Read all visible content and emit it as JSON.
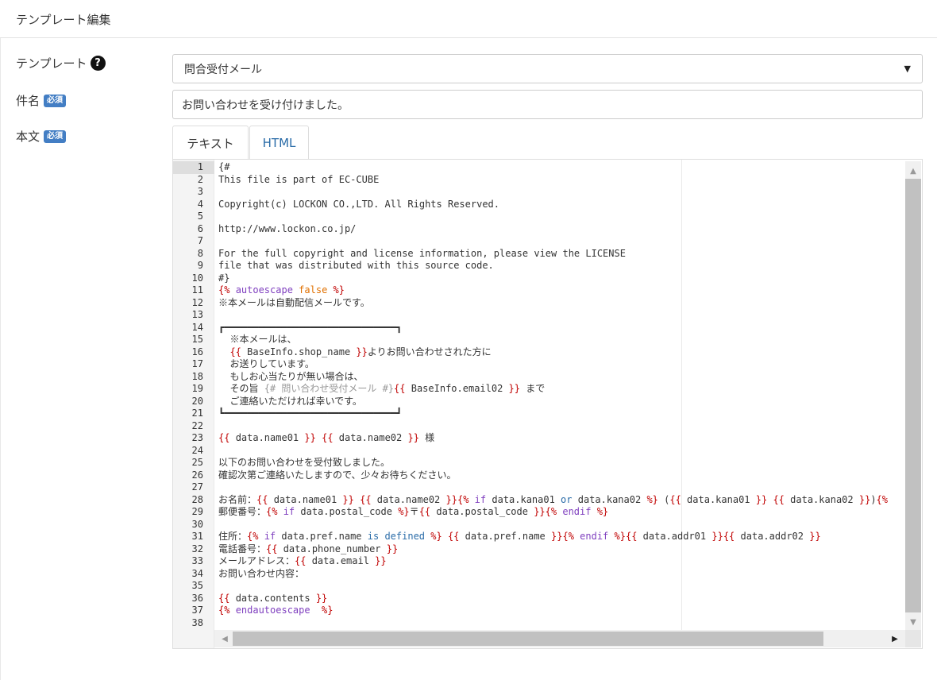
{
  "header": {
    "title": "テンプレート編集"
  },
  "form": {
    "template_label": "テンプレート",
    "subject_label": "件名",
    "body_label": "本文",
    "required_badge": "必須",
    "help_icon_glyph": "?",
    "template_select_value": "問合受付メール",
    "subject_value": "お問い合わせを受け付けました。"
  },
  "tabs": [
    {
      "label": "テキスト",
      "active": true
    },
    {
      "label": "HTML",
      "active": false
    }
  ],
  "editor": {
    "lines": [
      [
        [
          "{#",
          ""
        ]
      ],
      [
        [
          "This file is part of EC-CUBE",
          ""
        ]
      ],
      [
        [
          "",
          ""
        ]
      ],
      [
        [
          "Copyright(c) LOCKON CO.,LTD. All Rights Reserved.",
          ""
        ]
      ],
      [
        [
          "",
          ""
        ]
      ],
      [
        [
          "http://www.lockon.co.jp/",
          ""
        ]
      ],
      [
        [
          "",
          ""
        ]
      ],
      [
        [
          "For the full copyright and license information, please view the LICENSE",
          ""
        ]
      ],
      [
        [
          "file that was distributed with this source code.",
          ""
        ]
      ],
      [
        [
          "#}",
          ""
        ]
      ],
      [
        [
          "{% ",
          "tag"
        ],
        [
          "autoescape ",
          "kw"
        ],
        [
          "false",
          "bool"
        ],
        [
          " %}",
          "tag"
        ]
      ],
      [
        [
          "※本メールは自動配信メールです。",
          ""
        ]
      ],
      [
        [
          "",
          ""
        ]
      ],
      [
        [
          "┏━━━━━━━━━━━━━━━━━━━━━━━━━━━━━━┓",
          ""
        ]
      ],
      [
        [
          "  ※本メールは、",
          ""
        ]
      ],
      [
        [
          "  ",
          ""
        ],
        [
          "{{ ",
          "tag"
        ],
        [
          "BaseInfo.shop_name",
          ""
        ],
        [
          " }}",
          "tag"
        ],
        [
          "よりお問い合わせされた方に",
          ""
        ]
      ],
      [
        [
          "  お送りしています。",
          ""
        ]
      ],
      [
        [
          "  もしお心当たりが無い場合は、",
          ""
        ]
      ],
      [
        [
          "  その旨 ",
          ""
        ],
        [
          "{# 問い合わせ受付メール #}",
          "cm"
        ],
        [
          "{{ ",
          "tag"
        ],
        [
          "BaseInfo.email02",
          ""
        ],
        [
          " }}",
          "tag"
        ],
        [
          " まで",
          ""
        ]
      ],
      [
        [
          "  ご連絡いただければ幸いです。",
          ""
        ]
      ],
      [
        [
          "┗━━━━━━━━━━━━━━━━━━━━━━━━━━━━━━┛",
          ""
        ]
      ],
      [
        [
          "",
          ""
        ]
      ],
      [
        [
          "{{ ",
          "tag"
        ],
        [
          "data.name01",
          ""
        ],
        [
          " }}",
          "tag"
        ],
        [
          " ",
          ""
        ],
        [
          "{{ ",
          "tag"
        ],
        [
          "data.name02",
          ""
        ],
        [
          " }}",
          "tag"
        ],
        [
          " 様",
          ""
        ]
      ],
      [
        [
          "",
          ""
        ]
      ],
      [
        [
          "以下のお問い合わせを受付致しました。",
          ""
        ]
      ],
      [
        [
          "確認次第ご連絡いたしますので、少々お待ちください。",
          ""
        ]
      ],
      [
        [
          "",
          ""
        ]
      ],
      [
        [
          "お名前：",
          ""
        ],
        [
          "{{ ",
          "tag"
        ],
        [
          "data.name01",
          ""
        ],
        [
          " }}",
          "tag"
        ],
        [
          " ",
          ""
        ],
        [
          "{{ ",
          "tag"
        ],
        [
          "data.name02",
          ""
        ],
        [
          " }}",
          "tag"
        ],
        [
          "{% ",
          "tag"
        ],
        [
          "if ",
          "kw"
        ],
        [
          "data.kana01 ",
          ""
        ],
        [
          "or ",
          "op"
        ],
        [
          "data.kana02",
          ""
        ],
        [
          " %}",
          "tag"
        ],
        [
          " (",
          ""
        ],
        [
          "{{ ",
          "tag"
        ],
        [
          "data.kana01",
          ""
        ],
        [
          " }}",
          "tag"
        ],
        [
          " ",
          ""
        ],
        [
          "{{ ",
          "tag"
        ],
        [
          "data.kana02",
          ""
        ],
        [
          " }}",
          "tag"
        ],
        [
          ")",
          ""
        ],
        [
          "{%",
          "tag"
        ]
      ],
      [
        [
          "郵便番号：",
          ""
        ],
        [
          "{% ",
          "tag"
        ],
        [
          "if ",
          "kw"
        ],
        [
          "data.postal_code",
          ""
        ],
        [
          " %}",
          "tag"
        ],
        [
          "〒",
          ""
        ],
        [
          "{{ ",
          "tag"
        ],
        [
          "data.postal_code",
          ""
        ],
        [
          " }}",
          "tag"
        ],
        [
          "{% ",
          "tag"
        ],
        [
          "endif",
          "kw"
        ],
        [
          " %}",
          "tag"
        ]
      ],
      [
        [
          "",
          ""
        ]
      ],
      [
        [
          "住所：",
          ""
        ],
        [
          "{% ",
          "tag"
        ],
        [
          "if ",
          "kw"
        ],
        [
          "data.pref.name ",
          ""
        ],
        [
          "is defined",
          "op"
        ],
        [
          " %}",
          "tag"
        ],
        [
          " ",
          ""
        ],
        [
          "{{ ",
          "tag"
        ],
        [
          "data.pref.name",
          ""
        ],
        [
          " }}",
          "tag"
        ],
        [
          "{% ",
          "tag"
        ],
        [
          "endif",
          "kw"
        ],
        [
          " %}",
          "tag"
        ],
        [
          "{{ ",
          "tag"
        ],
        [
          "data.addr01",
          ""
        ],
        [
          " }}",
          "tag"
        ],
        [
          "{{ ",
          "tag"
        ],
        [
          "data.addr02",
          ""
        ],
        [
          " }}",
          "tag"
        ]
      ],
      [
        [
          "電話番号：",
          ""
        ],
        [
          "{{ ",
          "tag"
        ],
        [
          "data.phone_number",
          ""
        ],
        [
          " }}",
          "tag"
        ]
      ],
      [
        [
          "メールアドレス：",
          ""
        ],
        [
          "{{ ",
          "tag"
        ],
        [
          "data.email",
          ""
        ],
        [
          " }}",
          "tag"
        ]
      ],
      [
        [
          "お問い合わせ内容：",
          ""
        ]
      ],
      [
        [
          "",
          ""
        ]
      ],
      [
        [
          "{{ ",
          "tag"
        ],
        [
          "data.contents",
          ""
        ],
        [
          " }}",
          "tag"
        ]
      ],
      [
        [
          "{% ",
          "tag"
        ],
        [
          "endautoescape",
          "kw"
        ],
        [
          "  %}",
          "tag"
        ]
      ],
      [
        [
          "",
          ""
        ]
      ]
    ]
  }
}
